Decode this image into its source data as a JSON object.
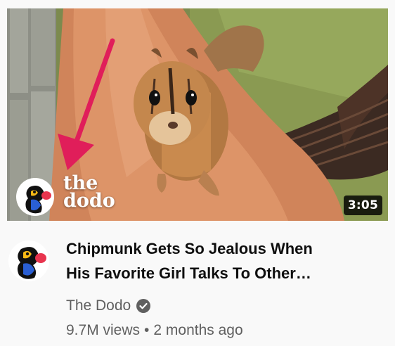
{
  "video": {
    "duration": "3:05",
    "title_line1": "Chipmunk Gets So Jealous When",
    "title_line2": "His Favorite Girl Talks To Other…",
    "watermark_line1": "the",
    "watermark_line2": "dodo"
  },
  "channel": {
    "name": "The Dodo",
    "verified_icon": "verified-check-icon",
    "avatar_icon": "dodo-bird-logo"
  },
  "stats": {
    "views": "9.7M views",
    "separator": "•",
    "age": "2 months ago"
  },
  "colors": {
    "title": "#0f0f0f",
    "secondary": "#606060",
    "arrow": "#e01e5a",
    "duration_bg": "#000000"
  }
}
